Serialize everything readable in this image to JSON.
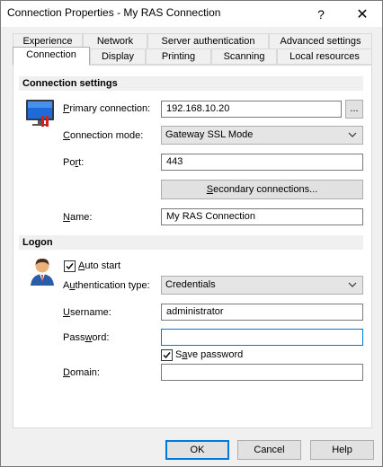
{
  "window": {
    "title": "Connection Properties - My RAS Connection",
    "help_glyph": "?",
    "close_glyph": "✕"
  },
  "tabs_row1": [
    "Experience",
    "Network",
    "Server authentication",
    "Advanced settings"
  ],
  "tabs_row2": [
    "Connection",
    "Display",
    "Printing",
    "Scanning",
    "Local resources"
  ],
  "active_tab": "Connection",
  "connection_settings": {
    "header": "Connection settings",
    "primary_label_u": "P",
    "primary_label_rest": "rimary connection:",
    "primary_value": "192.168.10.20",
    "browse_label": "...",
    "mode_label_u": "C",
    "mode_label_rest": "onnection mode:",
    "mode_value": "Gateway SSL Mode",
    "port_label_a": "Po",
    "port_label_u": "r",
    "port_label_b": "t:",
    "port_value": "443",
    "secondary_button_u": "S",
    "secondary_button_rest": "econdary connections...",
    "name_label_u": "N",
    "name_label_rest": "ame:",
    "name_value": "My RAS Connection"
  },
  "logon": {
    "header": "Logon",
    "auto_start_label_u": "A",
    "auto_start_label_rest": "uto start",
    "auto_start_checked": true,
    "auth_label_a": "A",
    "auth_label_u": "u",
    "auth_label_b": "thentication type:",
    "auth_value": "Credentials",
    "username_label_u": "U",
    "username_label_rest": "sername:",
    "username_value": "administrator",
    "password_label_a": "Pass",
    "password_label_u": "w",
    "password_label_b": "ord:",
    "password_value": "",
    "save_password_label_a": "S",
    "save_password_label_u": "a",
    "save_password_label_b": "ve password",
    "save_password_checked": true,
    "domain_label_u": "D",
    "domain_label_rest": "omain:",
    "domain_value": ""
  },
  "footer": {
    "ok": "OK",
    "cancel": "Cancel",
    "help": "Help"
  }
}
